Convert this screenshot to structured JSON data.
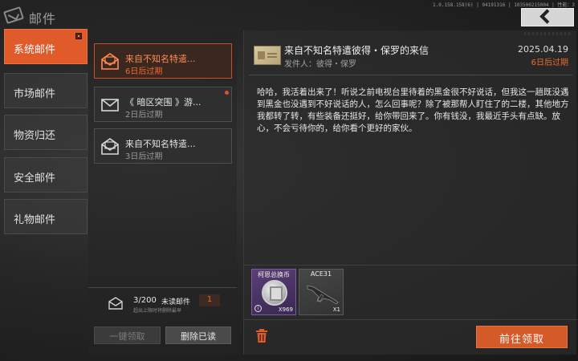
{
  "header": {
    "title": "邮件",
    "build_info": "1.0.158.158(6) | 04191316 | 103500215004 | 性能：3",
    "back_icon": "chevron-left-icon"
  },
  "sidebar": {
    "items": [
      {
        "label": "系统邮件",
        "active": true,
        "has_badge": true
      },
      {
        "label": "市场邮件",
        "active": false
      },
      {
        "label": "物资归还",
        "active": false
      },
      {
        "label": "安全邮件",
        "active": false
      },
      {
        "label": "礼物邮件",
        "active": false
      }
    ]
  },
  "mail_list": {
    "items": [
      {
        "subject": "来自不知名特遣...",
        "expire": "6日后过期",
        "icon": "envelope-open-icon",
        "active": true,
        "unread": false
      },
      {
        "subject": "《 暗区突围 》游...",
        "expire": "2日后过期",
        "icon": "envelope-closed-icon",
        "active": false,
        "unread": true
      },
      {
        "subject": "来自不知名特遣...",
        "expire": "3日后过期",
        "icon": "envelope-open-icon",
        "active": false,
        "unread": false
      }
    ],
    "footer": {
      "count": "3/200",
      "unread_label": "未读邮件",
      "unread_count": "1",
      "hint": "超出上限时将删除最早"
    },
    "claim_all_label": "一键领取",
    "delete_read_label": "删除已读"
  },
  "detail": {
    "subject": "来自不知名特遣彼得・保罗的来信",
    "sender": "发件人：彼得・保罗",
    "date": "2025.04.19",
    "expire": "6日后过期",
    "body": "哈哈，我活着出来了！听说之前电视台里待着的黑金很不好说话，但我这一趟既没遇到黑金也没遇到不好说话的人，怎么回事呢？除了被那帮人盯住了的二楼，其他地方我都转了转，有些装备还挺好，给你带回来了。你有钱没，我最近手头有点缺。放心，不会亏待你的，给你看个更好的家伙。",
    "attachments": [
      {
        "name": "柯恩总换币",
        "quantity": "X969",
        "icon": "coin-icon",
        "rarity_color": "#5a3f78"
      },
      {
        "name": "ACE31",
        "quantity": "X1",
        "icon": "rifle-icon",
        "rarity_color": "#474747"
      }
    ],
    "goto_claim_label": "前往领取",
    "delete_icon": "trash-icon"
  },
  "colors": {
    "accent": "#e05a2a",
    "expire_text": "#f26a30"
  }
}
